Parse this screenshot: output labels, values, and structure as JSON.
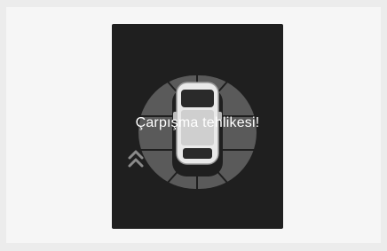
{
  "warning_message": "Çarpışma tehlikesi!",
  "icons": {
    "car": "car-top-view-icon",
    "sensor_zones": "parking-sensor-zones-icon",
    "approach": "double-chevron-up-icon"
  },
  "colors": {
    "page_background": "#ececec",
    "display_background": "#1f1f1f",
    "zone_fill": "#5a5a5a",
    "zone_divider": "#1f1f1f",
    "approach_chevron": "#8a8a8a",
    "text": "#ffffff"
  }
}
